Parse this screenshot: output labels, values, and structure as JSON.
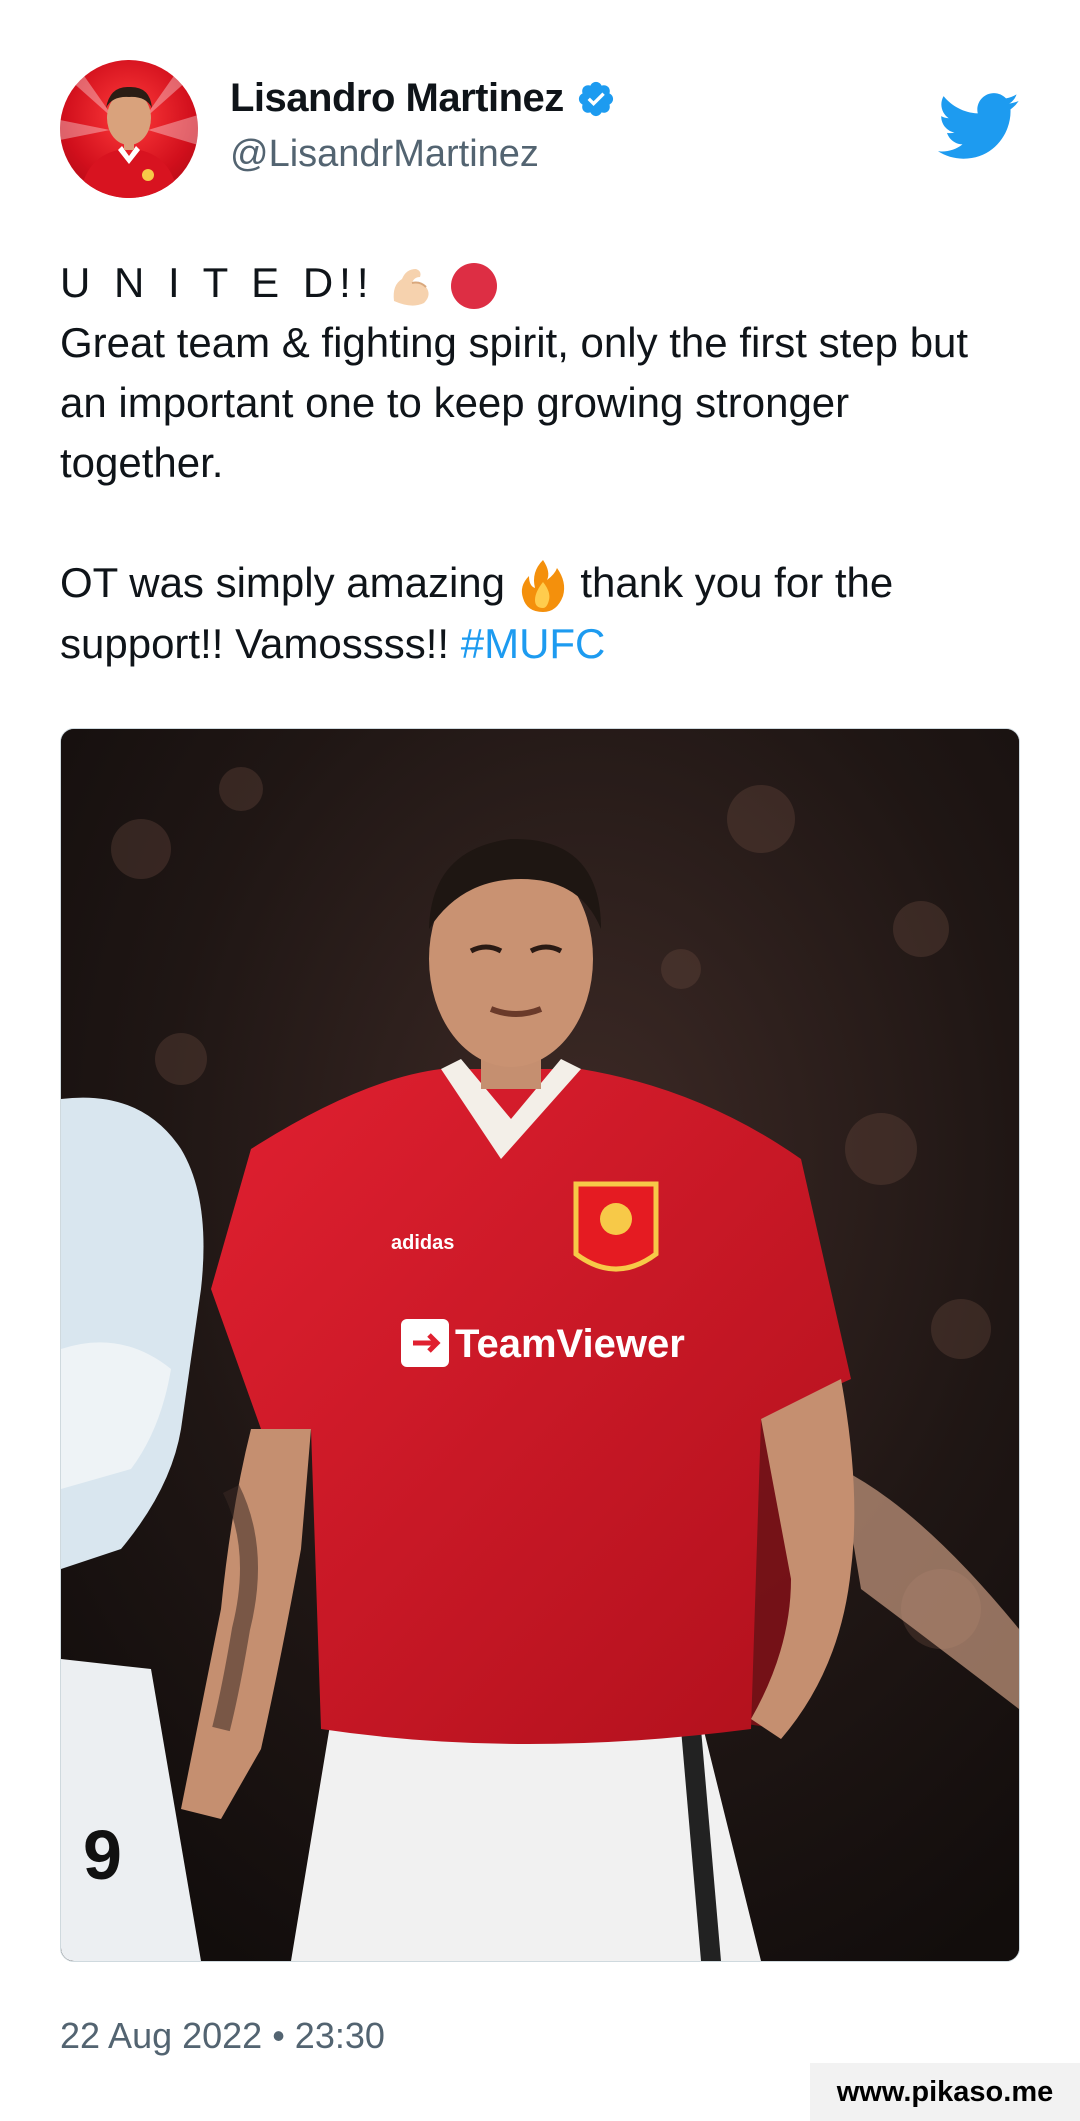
{
  "user": {
    "display_name": "Lisandro Martinez",
    "handle": "@LisandrMartinez",
    "verified": true,
    "avatar_icon": "player-portrait-avatar"
  },
  "brand": {
    "logo_icon": "twitter-bird-icon",
    "color": "#1d9bf0"
  },
  "tweet": {
    "line1": "U N I T E D!!",
    "line1_emojis": [
      "flexed-biceps-icon",
      "red-circle-icon"
    ],
    "para1": "Great team & fighting spirit, only the first step but an important one to keep growing stronger together.",
    "para2_before": "OT was simply amazing",
    "para2_emoji": "fire-icon",
    "para2_after": "thank you for the support!! Vamossss!!",
    "hashtag": "#MUFC"
  },
  "media": {
    "description_icon": "football-player-photo",
    "jersey_sponsor": "TeamViewer",
    "jersey_brand": "adidas"
  },
  "timestamp": "22 Aug 2022 • 23:30",
  "watermark": "www.pikaso.me"
}
